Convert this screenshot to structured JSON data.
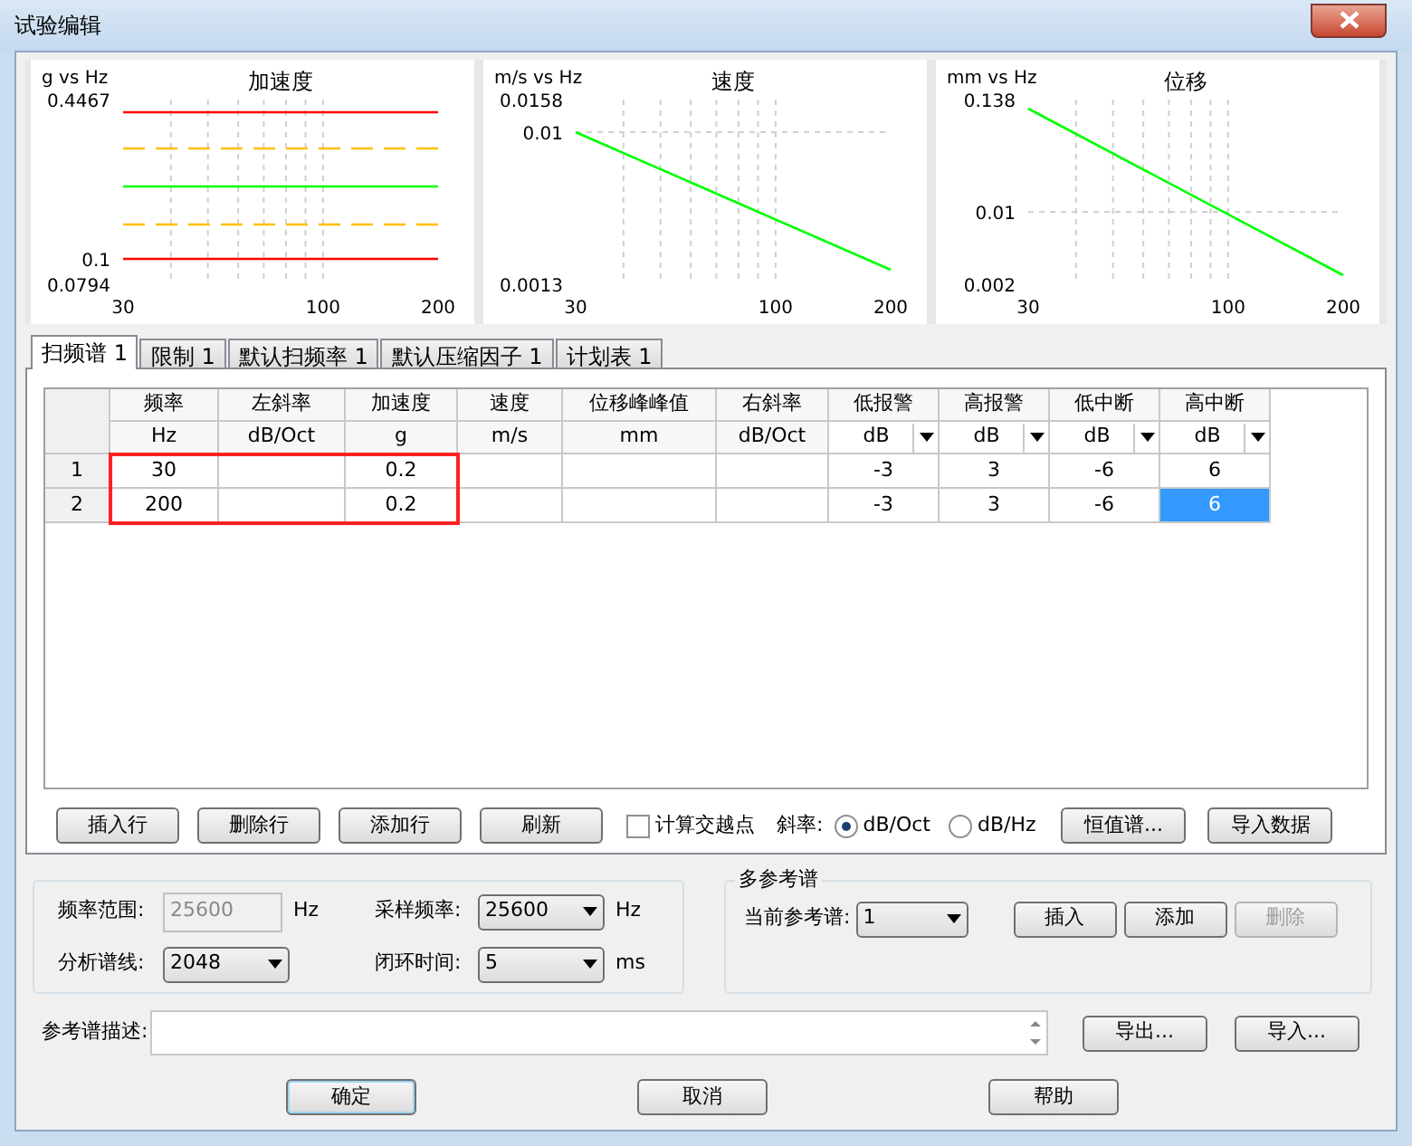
{
  "window": {
    "title": "试验编辑"
  },
  "charts": [
    {
      "kind": "limit_lines",
      "title": "加速度",
      "unit_label": "g vs Hz",
      "y_tick_labels": [
        "0.4467",
        "0.1",
        "0.0794"
      ],
      "x_tick_labels": [
        "30",
        "100",
        "200"
      ]
    },
    {
      "kind": "falling_line",
      "title": "速度",
      "unit_label": "m/s vs Hz",
      "y_tick_labels": [
        "0.0158",
        "0.01",
        "0.0013"
      ],
      "x_tick_labels": [
        "30",
        "100",
        "200"
      ]
    },
    {
      "kind": "falling_line_low",
      "title": "位移",
      "unit_label": "mm vs Hz",
      "y_tick_labels": [
        "0.138",
        "0.01",
        "0.002"
      ],
      "x_tick_labels": [
        "30",
        "100",
        "200"
      ]
    }
  ],
  "tabs": [
    {
      "label": "扫频谱 1",
      "selected": true
    },
    {
      "label": "限制 1",
      "selected": false
    },
    {
      "label": "默认扫频率 1",
      "selected": false
    },
    {
      "label": "默认压缩因子 1",
      "selected": false
    },
    {
      "label": "计划表 1",
      "selected": false
    }
  ],
  "table": {
    "columns": [
      {
        "header": "频率",
        "unit": "Hz",
        "unit_dropdown": false,
        "highlighted": true
      },
      {
        "header": "左斜率",
        "unit": "dB/Oct",
        "unit_dropdown": false,
        "highlighted": true
      },
      {
        "header": "加速度",
        "unit": "g",
        "unit_dropdown": false,
        "highlighted": true
      },
      {
        "header": "速度",
        "unit": "m/s",
        "unit_dropdown": false,
        "highlighted": false
      },
      {
        "header": "位移峰峰值",
        "unit": "mm",
        "unit_dropdown": false,
        "highlighted": false
      },
      {
        "header": "右斜率",
        "unit": "dB/Oct",
        "unit_dropdown": false,
        "highlighted": false
      },
      {
        "header": "低报警",
        "unit": "dB",
        "unit_dropdown": true,
        "highlighted": false
      },
      {
        "header": "高报警",
        "unit": "dB",
        "unit_dropdown": true,
        "highlighted": false
      },
      {
        "header": "低中断",
        "unit": "dB",
        "unit_dropdown": true,
        "highlighted": false
      },
      {
        "header": "高中断",
        "unit": "dB",
        "unit_dropdown": true,
        "highlighted": false
      }
    ],
    "rows": [
      {
        "label": "1",
        "cells": [
          {
            "text": "30",
            "selected": false
          },
          {
            "selected": false
          },
          {
            "text": "0.2",
            "selected": false
          },
          {
            "selected": false
          },
          {
            "selected": false
          },
          {
            "selected": false
          },
          {
            "text": "-3",
            "selected": false
          },
          {
            "text": "3",
            "selected": false
          },
          {
            "text": "-6",
            "selected": false
          },
          {
            "text": "6",
            "selected": false
          }
        ]
      },
      {
        "label": "2",
        "cells": [
          {
            "text": "200",
            "selected": false
          },
          {
            "selected": false
          },
          {
            "text": "0.2",
            "selected": false
          },
          {
            "selected": false
          },
          {
            "selected": false
          },
          {
            "selected": false
          },
          {
            "text": "-3",
            "selected": false
          },
          {
            "text": "3",
            "selected": false
          },
          {
            "text": "-6",
            "selected": false
          },
          {
            "text": "6",
            "selected": true
          }
        ]
      }
    ]
  },
  "toolbar": {
    "row_buttons": [
      {
        "label": "插入行"
      },
      {
        "label": "删除行"
      },
      {
        "label": "添加行"
      },
      {
        "label": "刷新"
      }
    ],
    "checkbox": {
      "label": "计算交越点",
      "checked": false
    },
    "slope": {
      "label": "斜率:",
      "options": [
        {
          "label": "dB/Oct",
          "selected": true
        },
        {
          "label": "dB/Hz",
          "selected": false
        }
      ]
    },
    "right_buttons": [
      {
        "label": "恒值谱..."
      },
      {
        "label": "导入数据"
      }
    ]
  },
  "settings": [
    {
      "label": "频率范围:",
      "value": "25600",
      "unit": "Hz",
      "kind": "text",
      "disabled": true
    },
    {
      "label": "采样频率:",
      "value": "25600",
      "unit": "Hz",
      "kind": "dropdown",
      "disabled": false
    },
    {
      "label": "分析谱线:",
      "value": "2048",
      "kind": "dropdown",
      "disabled": false
    },
    {
      "label": "闭环时间:",
      "value": "5",
      "unit": "ms",
      "kind": "dropdown",
      "disabled": false
    }
  ],
  "reference": {
    "title": "多参考谱",
    "current_label": "当前参考谱:",
    "current_value": "1",
    "buttons": [
      {
        "label": "插入",
        "disabled": false
      },
      {
        "label": "添加",
        "disabled": false
      },
      {
        "label": "删除",
        "disabled": true
      }
    ]
  },
  "description": {
    "label": "参考谱描述:",
    "buttons": [
      {
        "label": "导出..."
      },
      {
        "label": "导入..."
      }
    ]
  },
  "dialog_buttons": [
    {
      "label": "确定",
      "default": true
    },
    {
      "label": "取消",
      "default": false
    },
    {
      "label": "帮助",
      "default": false
    }
  ]
}
